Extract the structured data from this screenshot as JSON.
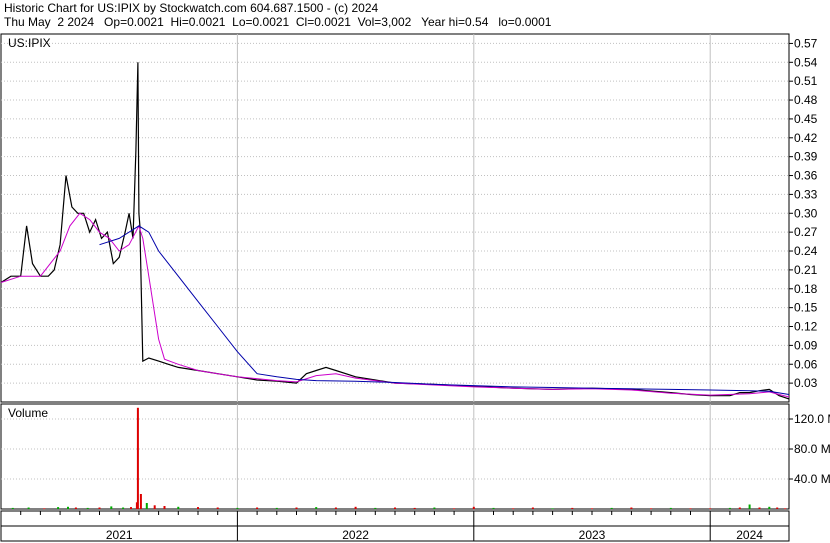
{
  "header": {
    "line1": "Historic Chart for US:IPIX by Stockwatch.com 604.687.1500 - (c) 2024",
    "line2": "Thu May  2 2024   Op=0.0021  Hi=0.0021  Lo=0.0021  Cl=0.0021  Vol=3,002   Year hi=0.54   lo=0.0001"
  },
  "colors": {
    "price": "#000000",
    "ma_short": "#cc00cc",
    "ma_long": "#0000aa",
    "volume_down": "#dd0000",
    "volume_up": "#00aa00",
    "grid": "#c0c0c0"
  },
  "chart_data": [
    {
      "type": "line",
      "title": "US:IPIX",
      "x_unit": "months since Jan 2021",
      "xlim": [
        0,
        40
      ],
      "ylim": [
        0,
        0.585
      ],
      "yticks": [
        "0.03",
        "0.06",
        "0.09",
        "0.12",
        "0.15",
        "0.18",
        "0.21",
        "0.24",
        "0.27",
        "0.30",
        "0.33",
        "0.36",
        "0.39",
        "0.42",
        "0.45",
        "0.48",
        "0.51",
        "0.54",
        "0.57"
      ],
      "xtick_labels": [
        "2021",
        "2022",
        "2023",
        "2024"
      ],
      "grid": true,
      "series": [
        {
          "key": "price",
          "x": [
            0,
            0.5,
            1,
            1.3,
            1.6,
            2,
            2.4,
            2.7,
            3,
            3.3,
            3.6,
            3.9,
            4.2,
            4.5,
            4.8,
            5.1,
            5.4,
            5.7,
            6.0,
            6.3,
            6.5,
            6.7,
            6.85,
            6.95,
            7.0,
            7.05,
            7.2,
            7.5,
            8,
            8.5,
            9,
            10,
            11,
            12,
            13,
            14,
            15,
            15.5,
            16,
            16.5,
            17,
            18,
            19,
            20,
            22,
            24,
            26,
            28,
            30,
            32,
            34,
            35,
            36,
            37,
            37.5,
            38,
            38.5,
            39,
            39.5,
            40
          ],
          "y": [
            0.19,
            0.2,
            0.2,
            0.28,
            0.22,
            0.2,
            0.2,
            0.21,
            0.25,
            0.36,
            0.31,
            0.3,
            0.3,
            0.27,
            0.29,
            0.26,
            0.27,
            0.22,
            0.23,
            0.27,
            0.3,
            0.26,
            0.4,
            0.54,
            0.3,
            0.28,
            0.065,
            0.07,
            0.065,
            0.06,
            0.055,
            0.05,
            0.045,
            0.04,
            0.035,
            0.033,
            0.03,
            0.045,
            0.05,
            0.055,
            0.05,
            0.04,
            0.035,
            0.03,
            0.028,
            0.025,
            0.022,
            0.02,
            0.022,
            0.02,
            0.015,
            0.012,
            0.01,
            0.01,
            0.015,
            0.015,
            0.018,
            0.02,
            0.01,
            0.005
          ]
        },
        {
          "key": "ma_short",
          "x": [
            0,
            1,
            2,
            3,
            3.5,
            4,
            4.5,
            5,
            5.5,
            6,
            6.5,
            7,
            7.2,
            7.5,
            8,
            8.3,
            9,
            10,
            11,
            12,
            14,
            15,
            16,
            17,
            18,
            20,
            22,
            24,
            26,
            28,
            30,
            32,
            34,
            36,
            38,
            39,
            39.5,
            40
          ],
          "y": [
            0.19,
            0.2,
            0.2,
            0.24,
            0.28,
            0.3,
            0.29,
            0.27,
            0.26,
            0.24,
            0.25,
            0.28,
            0.26,
            0.2,
            0.1,
            0.068,
            0.06,
            0.05,
            0.045,
            0.04,
            0.034,
            0.032,
            0.042,
            0.045,
            0.038,
            0.03,
            0.027,
            0.024,
            0.022,
            0.02,
            0.021,
            0.019,
            0.014,
            0.011,
            0.013,
            0.016,
            0.012,
            0.008
          ]
        },
        {
          "key": "ma_long",
          "x": [
            5,
            6,
            7,
            7.5,
            8,
            9,
            10,
            11,
            12,
            13,
            14,
            15,
            16,
            18,
            20,
            22,
            24,
            26,
            28,
            30,
            32,
            34,
            36,
            38,
            39,
            40
          ],
          "y": [
            0.25,
            0.26,
            0.28,
            0.27,
            0.24,
            0.2,
            0.16,
            0.12,
            0.08,
            0.045,
            0.04,
            0.036,
            0.034,
            0.033,
            0.031,
            0.028,
            0.026,
            0.024,
            0.023,
            0.022,
            0.021,
            0.02,
            0.019,
            0.018,
            0.017,
            0.012
          ]
        }
      ]
    },
    {
      "type": "bar",
      "title": "Volume",
      "x_unit": "months since Jan 2021",
      "xlim": [
        0,
        40
      ],
      "ylim": [
        0,
        140
      ],
      "yticks": [
        "40.0 M",
        "80.0 M",
        "120.0 M"
      ],
      "grid": true,
      "bars": {
        "x": [
          0.6,
          1.4,
          2.2,
          2.9,
          3.4,
          3.8,
          4.4,
          5.0,
          5.6,
          6.2,
          6.6,
          6.9,
          6.95,
          7.1,
          7.4,
          7.8,
          8.3,
          9,
          10,
          11,
          12,
          13,
          14,
          15,
          16,
          17,
          18,
          19,
          20,
          21,
          22,
          23,
          24,
          25,
          26,
          27,
          28,
          29,
          30,
          31,
          32,
          33,
          34,
          35,
          36,
          37,
          37.5,
          38,
          38.5,
          39,
          39.4,
          39.8
        ],
        "values": [
          1.5,
          2,
          1,
          2.5,
          3,
          2,
          1.5,
          2,
          3.5,
          2,
          2.5,
          9,
          135,
          20,
          8,
          5,
          4,
          3,
          2.5,
          2,
          1.5,
          2,
          1.5,
          2,
          2.5,
          2,
          3,
          1.5,
          2,
          1.5,
          2,
          1,
          3,
          1.5,
          1,
          2,
          1,
          1.5,
          1,
          1.5,
          2,
          1,
          1.5,
          1,
          1,
          1.5,
          2,
          6,
          2,
          3,
          2,
          1
        ],
        "direction": [
          "u",
          "u",
          "d",
          "u",
          "u",
          "d",
          "u",
          "d",
          "u",
          "u",
          "d",
          "d",
          "d",
          "d",
          "u",
          "d",
          "d",
          "u",
          "d",
          "d",
          "u",
          "d",
          "u",
          "d",
          "u",
          "d",
          "d",
          "u",
          "d",
          "d",
          "u",
          "d",
          "d",
          "u",
          "d",
          "d",
          "u",
          "d",
          "d",
          "u",
          "d",
          "d",
          "u",
          "d",
          "d",
          "u",
          "d",
          "u",
          "d",
          "u",
          "d",
          "d"
        ]
      }
    }
  ]
}
